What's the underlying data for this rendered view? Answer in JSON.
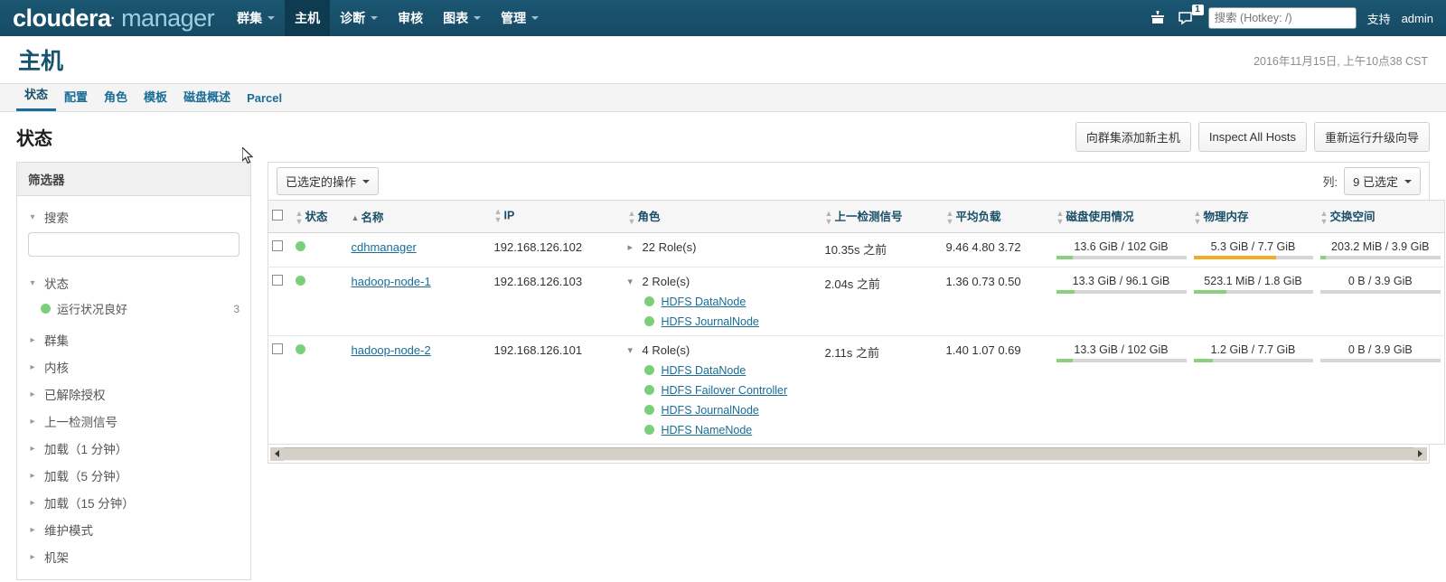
{
  "navbar": {
    "brand_first": "cloudera",
    "brand_dot": "·",
    "brand_second": "manager",
    "items": [
      {
        "label": "群集",
        "has_caret": true,
        "active": false
      },
      {
        "label": "主机",
        "has_caret": false,
        "active": true
      },
      {
        "label": "诊断",
        "has_caret": true,
        "active": false
      },
      {
        "label": "审核",
        "has_caret": false,
        "active": false
      },
      {
        "label": "图表",
        "has_caret": true,
        "active": false
      },
      {
        "label": "管理",
        "has_caret": true,
        "active": false
      }
    ],
    "parcel_icon": "parcel-icon",
    "alerts_icon": "alerts-icon",
    "alerts_badge": "1",
    "search_placeholder": "搜索 (Hotkey: /)",
    "search_value": "",
    "support_label": "支持",
    "user_label": "admin"
  },
  "page": {
    "title": "主机",
    "date": "2016年11月15日, 上午10点38 CST"
  },
  "tabs": [
    {
      "label": "状态",
      "active": true
    },
    {
      "label": "配置",
      "active": false
    },
    {
      "label": "角色",
      "active": false
    },
    {
      "label": "模板",
      "active": false
    },
    {
      "label": "磁盘概述",
      "active": false
    },
    {
      "label": "Parcel",
      "active": false
    }
  ],
  "section": {
    "title": "状态",
    "buttons": [
      "向群集添加新主机",
      "Inspect All Hosts",
      "重新运行升级向导"
    ]
  },
  "filters": {
    "header": "筛选器",
    "search_group_label": "搜索",
    "search_value": "",
    "status_group_label": "状态",
    "status_options": [
      {
        "label": "运行状况良好",
        "count": "3",
        "color": "#7ad07a"
      }
    ],
    "collapsed": [
      "群集",
      "内核",
      "已解除授权",
      "上一检测信号",
      "加载（1 分钟）",
      "加载（5 分钟）",
      "加载（15 分钟）",
      "维护模式",
      "机架"
    ]
  },
  "table": {
    "actions_button": "已选定的操作",
    "columns_label": "列:",
    "columns_value": "9 已选定",
    "headers": [
      {
        "label": "",
        "sort": "none",
        "key": "checkbox"
      },
      {
        "label": "状态",
        "sort": "none",
        "key": "status"
      },
      {
        "label": "名称",
        "sort": "asc",
        "key": "name"
      },
      {
        "label": "IP",
        "sort": "none",
        "key": "ip"
      },
      {
        "label": "角色",
        "sort": "none",
        "key": "roles"
      },
      {
        "label": "上一检测信号",
        "sort": "none",
        "key": "heartbeat"
      },
      {
        "label": "平均负载",
        "sort": "none",
        "key": "load"
      },
      {
        "label": "磁盘使用情况",
        "sort": "none",
        "key": "disk"
      },
      {
        "label": "物理内存",
        "sort": "none",
        "key": "mem"
      },
      {
        "label": "交换空间",
        "sort": "none",
        "key": "swap"
      }
    ],
    "rows": [
      {
        "checked": false,
        "status_color": "#7ad07a",
        "name": "cdhmanager",
        "ip": "192.168.126.102",
        "roles_summary": "22 Role(s)",
        "roles_expanded": false,
        "roles": [],
        "heartbeat": "10.35s 之前",
        "load": "9.46  4.80  3.72",
        "disk": {
          "label": "13.6 GiB / 102 GiB",
          "pct": 13,
          "color": "#8bd07a"
        },
        "mem": {
          "label": "5.3 GiB / 7.7 GiB",
          "pct": 69,
          "color": "#f0ad23"
        },
        "swap": {
          "label": "203.2 MiB / 3.9 GiB",
          "pct": 5,
          "color": "#8bd07a"
        }
      },
      {
        "checked": false,
        "status_color": "#7ad07a",
        "name": "hadoop-node-1",
        "ip": "192.168.126.103",
        "roles_summary": "2 Role(s)",
        "roles_expanded": true,
        "roles": [
          {
            "label": "HDFS DataNode",
            "color": "#7ad07a"
          },
          {
            "label": "HDFS JournalNode",
            "color": "#7ad07a"
          }
        ],
        "heartbeat": "2.04s 之前",
        "load": "1.36  0.73  0.50",
        "disk": {
          "label": "13.3 GiB / 96.1 GiB",
          "pct": 14,
          "color": "#8bd07a"
        },
        "mem": {
          "label": "523.1 MiB / 1.8 GiB",
          "pct": 28,
          "color": "#8bd07a"
        },
        "swap": {
          "label": "0 B / 3.9 GiB",
          "pct": 0,
          "color": "#8bd07a"
        }
      },
      {
        "checked": false,
        "status_color": "#7ad07a",
        "name": "hadoop-node-2",
        "ip": "192.168.126.101",
        "roles_summary": "4 Role(s)",
        "roles_expanded": true,
        "roles": [
          {
            "label": "HDFS DataNode",
            "color": "#7ad07a"
          },
          {
            "label": "HDFS Failover Controller",
            "color": "#7ad07a"
          },
          {
            "label": "HDFS JournalNode",
            "color": "#7ad07a"
          },
          {
            "label": "HDFS NameNode",
            "color": "#7ad07a"
          }
        ],
        "heartbeat": "2.11s 之前",
        "load": "1.40  1.07  0.69",
        "disk": {
          "label": "13.3 GiB / 102 GiB",
          "pct": 13,
          "color": "#8bd07a"
        },
        "mem": {
          "label": "1.2 GiB / 7.7 GiB",
          "pct": 16,
          "color": "#8bd07a"
        },
        "swap": {
          "label": "0 B / 3.9 GiB",
          "pct": 0,
          "color": "#8bd07a"
        }
      }
    ]
  },
  "colors": {
    "nav_bg": "#19506b",
    "brand_light": "#9ecfe0",
    "link": "#1a6d96",
    "title": "#16536e",
    "green": "#7ad07a",
    "amber": "#f0ad23"
  }
}
